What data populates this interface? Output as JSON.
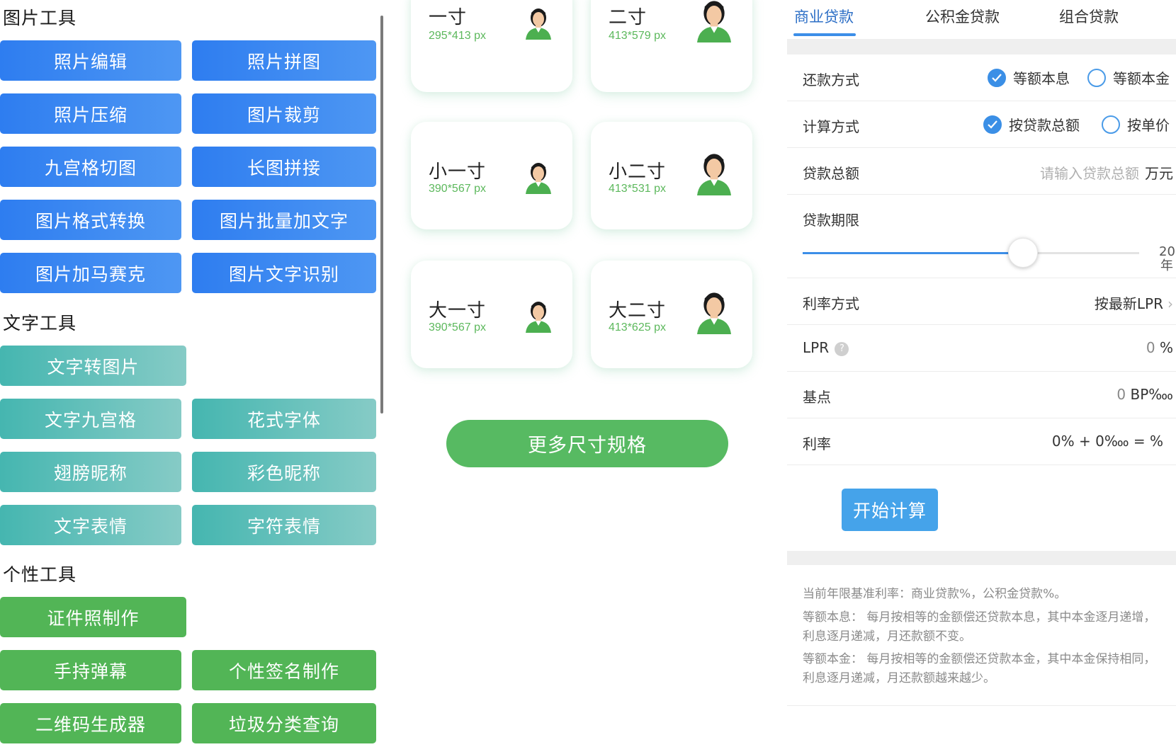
{
  "left": {
    "sections": [
      {
        "title": "图片工具"
      },
      {
        "title": "文字工具"
      },
      {
        "title": "个性工具"
      }
    ],
    "image_tools": [
      "照片编辑",
      "照片拼图",
      "照片压缩",
      "图片裁剪",
      "九宫格切图",
      "长图拼接",
      "图片格式转换",
      "图片批量加文字",
      "图片加马赛克",
      "图片文字识别"
    ],
    "text_tools": [
      "文字转图片",
      "文字九宫格",
      "花式字体",
      "翅膀昵称",
      "彩色昵称",
      "文字表情",
      "字符表情"
    ],
    "personal_tools": [
      "证件照制作",
      "手持弹幕",
      "个性签名制作",
      "二维码生成器",
      "垃圾分类查询"
    ]
  },
  "middle": {
    "sizes": [
      {
        "name": "一寸",
        "dim": "295*413 px"
      },
      {
        "name": "二寸",
        "dim": "413*579 px"
      },
      {
        "name": "小一寸",
        "dim": "390*567 px"
      },
      {
        "name": "小二寸",
        "dim": "413*531 px"
      },
      {
        "name": "大一寸",
        "dim": "390*567 px"
      },
      {
        "name": "大二寸",
        "dim": "413*625 px"
      }
    ],
    "more_button": "更多尺寸规格"
  },
  "right": {
    "tabs": [
      "商业贷款",
      "公积金贷款",
      "组合贷款"
    ],
    "repay_method": {
      "label": "还款方式",
      "options": [
        "等额本息",
        "等额本金"
      ],
      "selected": "等额本息"
    },
    "calc_method": {
      "label": "计算方式",
      "options": [
        "按贷款总额",
        "按单价"
      ],
      "selected": "按贷款总额"
    },
    "loan_total": {
      "label": "贷款总额",
      "placeholder": "请输入贷款总额",
      "unit": "万元"
    },
    "loan_term": {
      "label": "贷款期限",
      "value": 20,
      "max": 30,
      "unit": "年",
      "display": "20"
    },
    "rate_method": {
      "label": "利率方式",
      "value": "按最新LPR"
    },
    "lpr": {
      "label": "LPR",
      "value": "0",
      "unit": "%"
    },
    "bp": {
      "label": "基点",
      "value": "0",
      "unit": "BP‱"
    },
    "rate": {
      "label": "利率",
      "value": "0% + 0‱ = %"
    },
    "calc_button": "开始计算",
    "notes": [
      "当前年限基准利率：商业贷款%，公积金贷款%。",
      "等额本息：  每月按相等的金额偿还贷款本息，其中本金逐月递增，利息逐月递减，月还款额不变。",
      "等额本金：  每月按相等的金额偿还贷款本金，其中本金保持相同，利息逐月递减，月还款额越来越少。"
    ],
    "colors": {
      "accent": "#3c8ee8",
      "button": "#45a3ea"
    }
  }
}
